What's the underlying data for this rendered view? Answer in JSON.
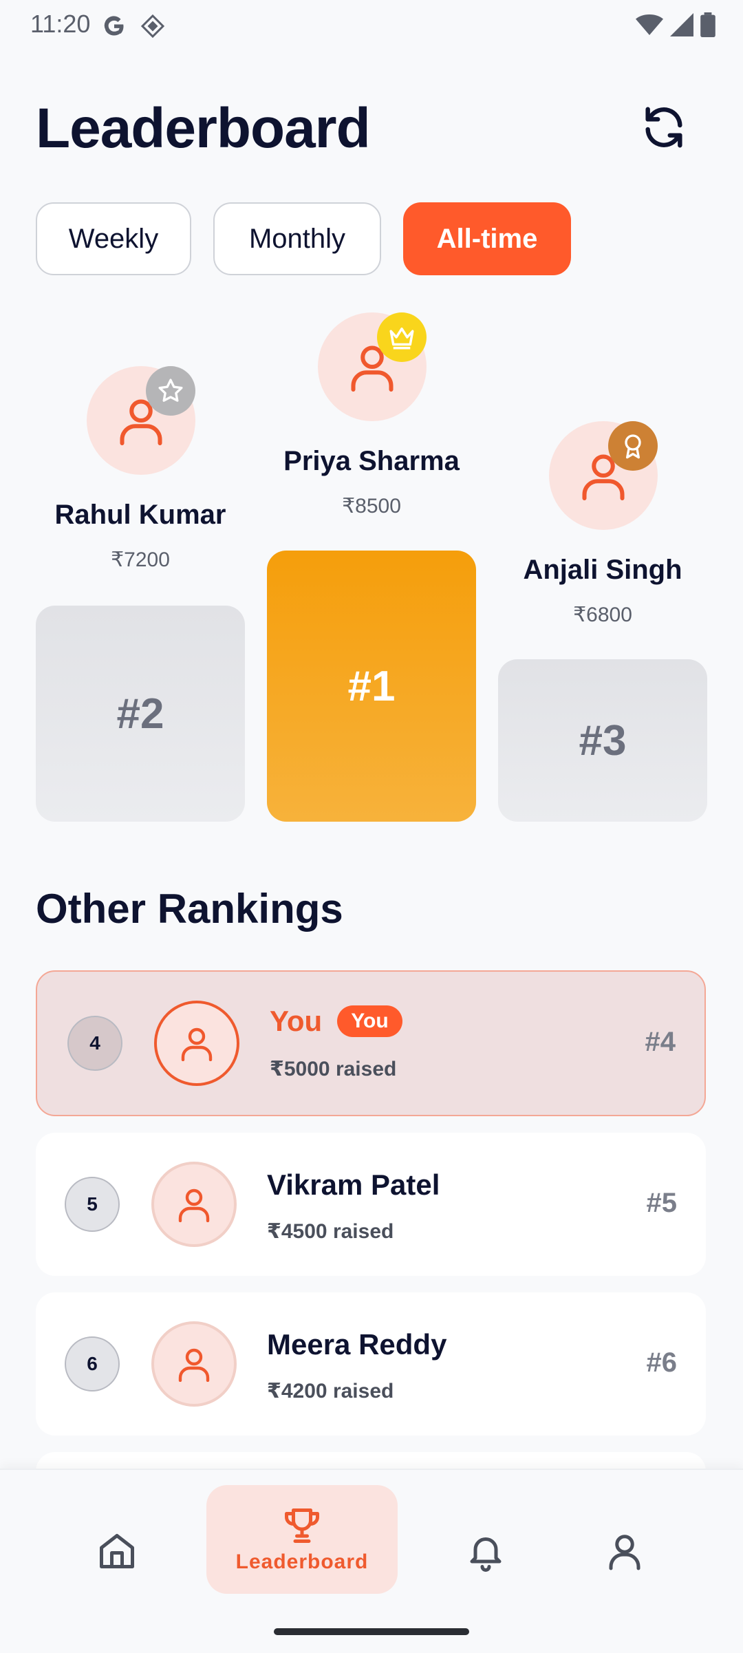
{
  "status_bar": {
    "time": "11:20",
    "icons": [
      "google-icon",
      "app-icon",
      "wifi-icon",
      "signal-icon",
      "battery-icon"
    ]
  },
  "header": {
    "title": "Leaderboard",
    "refresh_icon": "refresh-icon"
  },
  "filters": [
    {
      "label": "Weekly",
      "active": false
    },
    {
      "label": "Monthly",
      "active": false
    },
    {
      "label": "All-time",
      "active": true
    }
  ],
  "podium": {
    "first": {
      "name": "Priya Sharma",
      "amount": "₹8500",
      "rank": "#1",
      "badge": "crown-icon",
      "badge_color": "#f9d51c"
    },
    "second": {
      "name": "Rahul Kumar",
      "amount": "₹7200",
      "rank": "#2",
      "badge": "star-icon",
      "badge_color": "#b5b5b7"
    },
    "third": {
      "name": "Anjali Singh",
      "amount": "₹6800",
      "rank": "#3",
      "badge": "medal-icon",
      "badge_color": "#cd8134"
    }
  },
  "rankings": {
    "title": "Other Rankings",
    "rows": [
      {
        "position": "4",
        "name": "You",
        "tag": "You",
        "amount": "₹5000 raised",
        "rank": "#4",
        "is_me": true
      },
      {
        "position": "5",
        "name": "Vikram Patel",
        "amount": "₹4500 raised",
        "rank": "#5",
        "is_me": false
      },
      {
        "position": "6",
        "name": "Meera Reddy",
        "amount": "₹4200 raised",
        "rank": "#6",
        "is_me": false
      }
    ]
  },
  "nav": {
    "items": [
      {
        "icon": "home-icon",
        "label": ""
      },
      {
        "icon": "trophy-icon",
        "label": "Leaderboard",
        "active": true
      },
      {
        "icon": "bell-icon",
        "label": ""
      },
      {
        "icon": "profile-icon",
        "label": ""
      }
    ]
  },
  "colors": {
    "accent": "#ff5a2b",
    "gold": "#f59e0b",
    "text": "#0e1330"
  }
}
